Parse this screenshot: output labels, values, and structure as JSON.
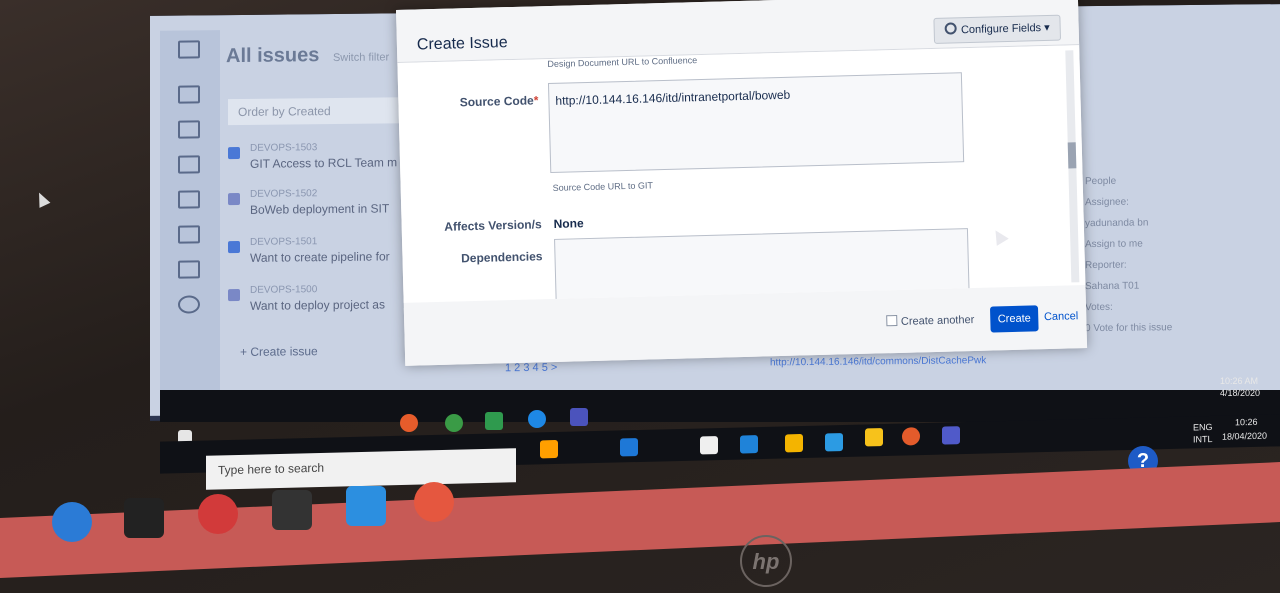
{
  "background_app": {
    "header": "All issues",
    "header_small": "Switch filter",
    "order_by": "Order by Created",
    "issues": [
      {
        "key": "DEVOPS-1503",
        "title": "GIT Access to RCL Team m"
      },
      {
        "key": "DEVOPS-1502",
        "title": "BoWeb deployment in SIT"
      },
      {
        "key": "DEVOPS-1501",
        "title": "Want to create pipeline for"
      },
      {
        "key": "DEVOPS-1500",
        "title": "Want to deploy project as"
      }
    ],
    "create_issue_link": "+ Create issue",
    "pager": "1 2 3 4 5 >",
    "url": "http://10.144.16.146/itd/commons/DistCachePwk",
    "right_panel": {
      "people": "People",
      "assignee": "Assignee:",
      "assignee_name": "yadunanda bn",
      "assign_to_me": "Assign to me",
      "reporter": "Reporter:",
      "reporter_name": "Sahana T01",
      "votes": "Votes:",
      "vote_count": "0",
      "vote_link": "Vote for this issue"
    }
  },
  "modal": {
    "title": "Create Issue",
    "configure_fields": "Configure Fields",
    "cut_hint": "Design Document URL to Confluence",
    "source_code_label": "Source Code",
    "source_code_value": "http://10.144.16.146/itd/intranetportal/boweb",
    "source_code_helper": "Source Code URL to GIT",
    "affects_label": "Affects Version/s",
    "affects_value": "None",
    "dependencies_label": "Dependencies",
    "create_another": "Create another",
    "create_button": "Create",
    "cancel": "Cancel"
  },
  "taskbar": {
    "search_placeholder": "Type here to search",
    "tray_time_1": "10:26 AM",
    "tray_date_1": "4/18/2020",
    "tray_lang": "ENG",
    "tray_layout": "INTL",
    "tray_time_2": "10:26",
    "tray_date_2": "18/04/2020"
  },
  "colors": {
    "primary": "#0052cc",
    "taskbar": "#0f1116",
    "laptop_bar": "#c75a56"
  }
}
